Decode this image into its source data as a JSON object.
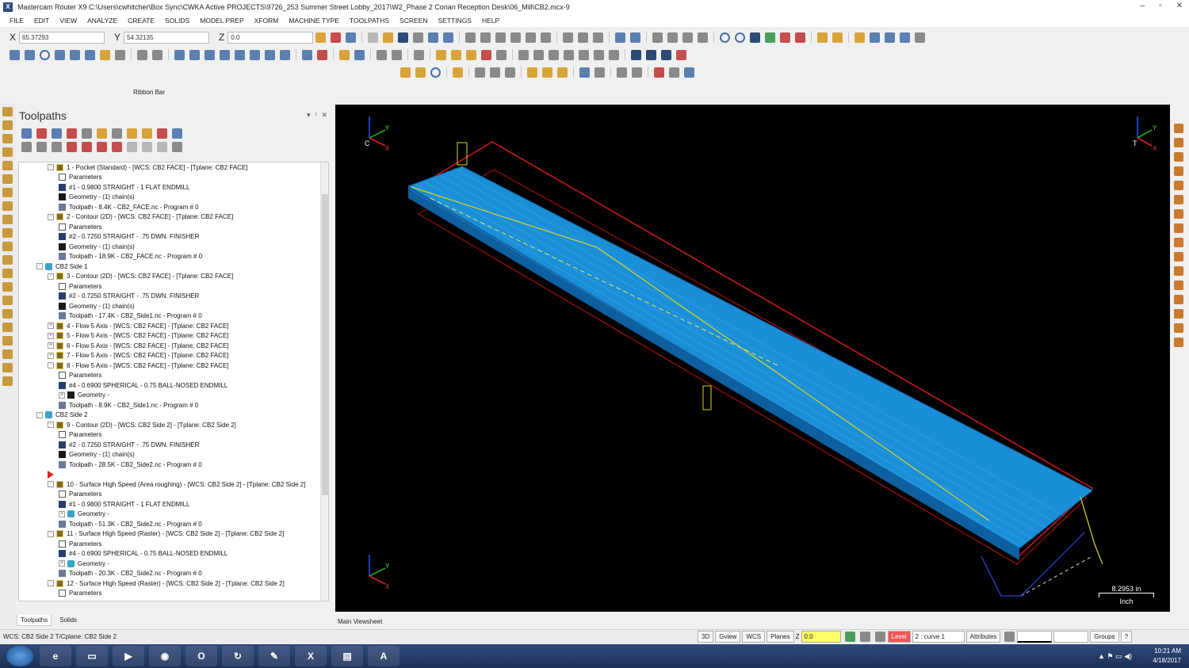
{
  "window": {
    "title": "Mastercam Router X9  C:\\Users\\cwhitcher\\Box Sync\\CWKA Active PROJECTS\\9726_253 Summer Street Lobby_2017\\W2_Phase 2 Corian Reception Desk\\06_Mill\\CB2.mcx-9",
    "controls": [
      "–",
      "▫",
      "✕"
    ]
  },
  "menu": [
    "FILE",
    "EDIT",
    "VIEW",
    "ANALYZE",
    "CREATE",
    "SOLIDS",
    "MODEL PREP",
    "XFORM",
    "MACHINE TYPE",
    "TOOLPATHS",
    "SCREEN",
    "SETTINGS",
    "HELP"
  ],
  "coords": {
    "x_label": "X",
    "x_value": "65.37293",
    "y_label": "Y",
    "y_value": "54.32135",
    "z_label": "Z",
    "z_value": "0.0"
  },
  "ribbon_label": "Ribbon Bar",
  "panel": {
    "title": "Toolpaths",
    "controls": [
      "▾",
      "ᵗ",
      "✕"
    ],
    "tabs": [
      "Toolpaths",
      "Solids"
    ]
  },
  "tree": [
    {
      "indent": 2,
      "icon": "op",
      "exp": "-",
      "label": "1 - Pocket (Standard) - [WCS: CB2 FACE] - [Tplane: CB2 FACE]"
    },
    {
      "indent": 3,
      "icon": "param",
      "label": "Parameters"
    },
    {
      "indent": 3,
      "icon": "tool",
      "label": "#1 - 0.9800 STRAIGHT - 1 FLAT ENDMILL"
    },
    {
      "indent": 3,
      "icon": "geom",
      "label": "Geometry - (1) chain(s)"
    },
    {
      "indent": 3,
      "icon": "path",
      "label": "Toolpath - 8.4K - CB2_FACE.nc - Program # 0"
    },
    {
      "indent": 2,
      "icon": "op",
      "exp": "-",
      "label": "2 - Contour (2D) - [WCS: CB2 FACE] - [Tplane: CB2 FACE]"
    },
    {
      "indent": 3,
      "icon": "param",
      "label": "Parameters"
    },
    {
      "indent": 3,
      "icon": "tool",
      "label": "#2 - 0.7250 STRAIGHT - .75 DWN. FINISHER"
    },
    {
      "indent": 3,
      "icon": "geom",
      "label": "Geometry - (1) chain(s)"
    },
    {
      "indent": 3,
      "icon": "path",
      "label": "Toolpath - 18.9K - CB2_FACE.nc - Program # 0"
    },
    {
      "indent": 1,
      "icon": "group",
      "exp": "-",
      "label": "CB2 Side 1"
    },
    {
      "indent": 2,
      "icon": "op",
      "exp": "-",
      "label": "3 - Contour (2D) - [WCS: CB2 FACE] - [Tplane: CB2 FACE]"
    },
    {
      "indent": 3,
      "icon": "param",
      "label": "Parameters"
    },
    {
      "indent": 3,
      "icon": "tool",
      "label": "#2 - 0.7250 STRAIGHT - .75 DWN. FINISHER"
    },
    {
      "indent": 3,
      "icon": "geom",
      "label": "Geometry - (1) chain(s)"
    },
    {
      "indent": 3,
      "icon": "path",
      "label": "Toolpath - 17.4K - CB2_Side1.nc - Program # 0"
    },
    {
      "indent": 2,
      "icon": "op",
      "exp": "+",
      "label": "4 - Flow 5 Axis - [WCS: CB2 FACE] - [Tplane: CB2 FACE]"
    },
    {
      "indent": 2,
      "icon": "op",
      "exp": "+",
      "label": "5 - Flow 5 Axis - [WCS: CB2 FACE] - [Tplane: CB2 FACE]"
    },
    {
      "indent": 2,
      "icon": "op",
      "exp": "+",
      "label": "6 - Flow 5 Axis - [WCS: CB2 FACE] - [Tplane: CB2 FACE]"
    },
    {
      "indent": 2,
      "icon": "op",
      "exp": "+",
      "label": "7 - Flow 5 Axis - [WCS: CB2 FACE] - [Tplane: CB2 FACE]"
    },
    {
      "indent": 2,
      "icon": "op",
      "exp": "-",
      "label": "8 - Flow 5 Axis - [WCS: CB2 FACE] - [Tplane: CB2 FACE]"
    },
    {
      "indent": 3,
      "icon": "param",
      "label": "Parameters"
    },
    {
      "indent": 3,
      "icon": "tool",
      "label": "#4 - 0.6900 SPHERICAL - 0.75 BALL-NOSED ENDMILL"
    },
    {
      "indent": 3,
      "icon": "geom",
      "exp": "+",
      "label": "Geometry -"
    },
    {
      "indent": 3,
      "icon": "path",
      "label": "Toolpath - 8.9K - CB2_Side1.nc - Program # 0"
    },
    {
      "indent": 1,
      "icon": "group",
      "exp": "-",
      "label": "CB2 Side 2"
    },
    {
      "indent": 2,
      "icon": "op",
      "exp": "-",
      "label": "9 - Contour (2D) - [WCS: CB2 Side 2] - [Tplane: CB2 Side 2]"
    },
    {
      "indent": 3,
      "icon": "param",
      "label": "Parameters"
    },
    {
      "indent": 3,
      "icon": "tool",
      "label": "#2 - 0.7250 STRAIGHT - .75 DWN. FINISHER"
    },
    {
      "indent": 3,
      "icon": "geom",
      "label": "Geometry - (1) chain(s)"
    },
    {
      "indent": 3,
      "icon": "path",
      "label": "Toolpath - 28.5K - CB2_Side2.nc - Program # 0"
    },
    {
      "indent": 2,
      "icon": "arrow",
      "label": ""
    },
    {
      "indent": 2,
      "icon": "op",
      "exp": "-",
      "label": "10 - Surface High Speed (Area roughing) - [WCS: CB2 Side 2] - [Tplane: CB2 Side 2]"
    },
    {
      "indent": 3,
      "icon": "param",
      "label": "Parameters"
    },
    {
      "indent": 3,
      "icon": "tool",
      "label": "#1 - 0.9800 STRAIGHT - 1 FLAT ENDMILL"
    },
    {
      "indent": 3,
      "icon": "group",
      "exp": "+",
      "label": "Geometry -"
    },
    {
      "indent": 3,
      "icon": "path",
      "label": "Toolpath - 51.3K - CB2_Side2.nc - Program # 0"
    },
    {
      "indent": 2,
      "icon": "op",
      "exp": "-",
      "label": "11 - Surface High Speed (Raster) - [WCS: CB2 Side 2] - [Tplane: CB2 Side 2]"
    },
    {
      "indent": 3,
      "icon": "param",
      "label": "Parameters"
    },
    {
      "indent": 3,
      "icon": "tool",
      "label": "#4 - 0.6900 SPHERICAL - 0.75 BALL-NOSED ENDMILL"
    },
    {
      "indent": 3,
      "icon": "group",
      "exp": "+",
      "label": "Geometry -"
    },
    {
      "indent": 3,
      "icon": "path",
      "label": "Toolpath - 20.3K - CB2_Side2.nc - Program # 0"
    },
    {
      "indent": 2,
      "icon": "op",
      "exp": "-",
      "label": "12 - Surface High Speed (Raster) - [WCS: CB2 Side 2] - [Tplane: CB2 Side 2]"
    },
    {
      "indent": 3,
      "icon": "param",
      "label": "Parameters"
    }
  ],
  "viewport": {
    "tab": "Main Viewsheet",
    "scale_value": "8.2953 in",
    "scale_unit": "Inch",
    "gnomon_c": "C",
    "gnomon_t": "T",
    "axis_x": "X",
    "axis_y": "Y",
    "colors": {
      "background": "#000000",
      "part": "#1a8fd8",
      "boundary": "#d01818",
      "path": "#d8d820"
    }
  },
  "status": {
    "left": "WCS: CB2 Side 2  T/Cplane: CB2 Side 2",
    "btn_3d": "3D",
    "btn_gview": "Gview",
    "btn_wcs": "WCS",
    "btn_planes": "Planes",
    "z_label": "Z",
    "z_value": "0.0",
    "level_label": "Level",
    "level_value": "2 : curve 1",
    "btn_attributes": "Attributes",
    "btn_groups": "Groups",
    "btn_help": "?"
  },
  "taskbar": {
    "time": "10:21 AM",
    "date": "4/18/2017"
  }
}
